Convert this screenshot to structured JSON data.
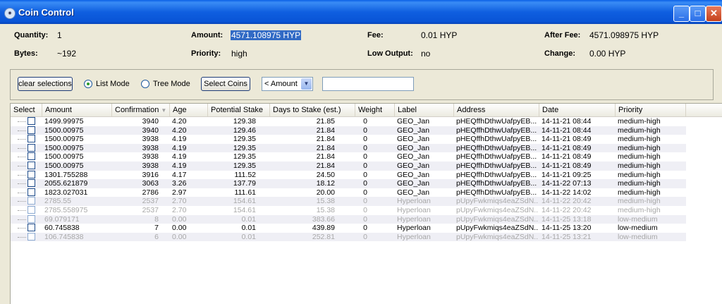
{
  "window": {
    "title": "Coin Control",
    "icon": "app-coin-icon"
  },
  "summary": {
    "quantity_label": "Quantity:",
    "quantity": "1",
    "bytes_label": "Bytes:",
    "bytes": "~192",
    "amount_label": "Amount:",
    "amount": "4571.108975 HYP",
    "priority_label": "Priority:",
    "priority": "high",
    "fee_label": "Fee:",
    "fee": "0.01 HYP",
    "low_output_label": "Low Output:",
    "low_output": "no",
    "after_fee_label": "After Fee:",
    "after_fee": "4571.098975 HYP",
    "change_label": "Change:",
    "change": "0.00 HYP"
  },
  "toolbar": {
    "clear_label": "clear selections",
    "list_mode_label": "List Mode",
    "tree_mode_label": "Tree Mode",
    "select_coins_label": "Select Coins",
    "amount_filter": "< Amount",
    "filter_value": ""
  },
  "table": {
    "headers": {
      "select": "Select",
      "amount": "Amount",
      "confirmations": "Confirmation",
      "age": "Age",
      "stake": "Potential Stake",
      "days": "Days to Stake (est.)",
      "weight": "Weight",
      "label": "Label",
      "address": "Address",
      "date": "Date",
      "priority": "Priority"
    },
    "rows": [
      {
        "amount": "1499.99975",
        "conf": "3940",
        "age": "4.20",
        "stake": "129.38",
        "days": "21.85",
        "weight": "0",
        "label": "GEO_Jan",
        "address": "pHEQffhDthwUafpyEB...",
        "date": "14-11-21 08:44",
        "priority": "medium-high"
      },
      {
        "amount": "1500.00975",
        "conf": "3940",
        "age": "4.20",
        "stake": "129.46",
        "days": "21.84",
        "weight": "0",
        "label": "GEO_Jan",
        "address": "pHEQffhDthwUafpyEB...",
        "date": "14-11-21 08:44",
        "priority": "medium-high"
      },
      {
        "amount": "1500.00975",
        "conf": "3938",
        "age": "4.19",
        "stake": "129.35",
        "days": "21.84",
        "weight": "0",
        "label": "GEO_Jan",
        "address": "pHEQffhDthwUafpyEB...",
        "date": "14-11-21 08:49",
        "priority": "medium-high"
      },
      {
        "amount": "1500.00975",
        "conf": "3938",
        "age": "4.19",
        "stake": "129.35",
        "days": "21.84",
        "weight": "0",
        "label": "GEO_Jan",
        "address": "pHEQffhDthwUafpyEB...",
        "date": "14-11-21 08:49",
        "priority": "medium-high"
      },
      {
        "amount": "1500.00975",
        "conf": "3938",
        "age": "4.19",
        "stake": "129.35",
        "days": "21.84",
        "weight": "0",
        "label": "GEO_Jan",
        "address": "pHEQffhDthwUafpyEB...",
        "date": "14-11-21 08:49",
        "priority": "medium-high"
      },
      {
        "amount": "1500.00975",
        "conf": "3938",
        "age": "4.19",
        "stake": "129.35",
        "days": "21.84",
        "weight": "0",
        "label": "GEO_Jan",
        "address": "pHEQffhDthwUafpyEB...",
        "date": "14-11-21 08:49",
        "priority": "medium-high"
      },
      {
        "amount": "1301.755288",
        "conf": "3916",
        "age": "4.17",
        "stake": "111.52",
        "days": "24.50",
        "weight": "0",
        "label": "GEO_Jan",
        "address": "pHEQffhDthwUafpyEB...",
        "date": "14-11-21 09:25",
        "priority": "medium-high"
      },
      {
        "amount": "2055.621879",
        "conf": "3063",
        "age": "3.26",
        "stake": "137.79",
        "days": "18.12",
        "weight": "0",
        "label": "GEO_Jan",
        "address": "pHEQffhDthwUafpyEB...",
        "date": "14-11-22 07:13",
        "priority": "medium-high"
      },
      {
        "amount": "1823.027031",
        "conf": "2786",
        "age": "2.97",
        "stake": "111.61",
        "days": "20.00",
        "weight": "0",
        "label": "GEO_Jan",
        "address": "pHEQffhDthwUafpyEB...",
        "date": "14-11-22 14:02",
        "priority": "medium-high"
      },
      {
        "amount": "2785.55",
        "conf": "2537",
        "age": "2.70",
        "stake": "154.61",
        "days": "15.38",
        "weight": "0",
        "label": "Hyperloan",
        "address": "pUpyFwkmiqs4eaZSdN...",
        "date": "14-11-22 20:42",
        "priority": "medium-high",
        "dim": true
      },
      {
        "amount": "2785.558975",
        "conf": "2537",
        "age": "2.70",
        "stake": "154.61",
        "days": "15.38",
        "weight": "0",
        "label": "Hyperloan",
        "address": "pUpyFwkmiqs4eaZSdN...",
        "date": "14-11-22 20:42",
        "priority": "medium-high",
        "dim": true
      },
      {
        "amount": "69.079171",
        "conf": "8",
        "age": "0.00",
        "stake": "0.01",
        "days": "383.66",
        "weight": "0",
        "label": "Hyperloan",
        "address": "pUpyFwkmiqs4eaZSdN...",
        "date": "14-11-25 13:18",
        "priority": "low-medium",
        "dim": true
      },
      {
        "amount": "60.745838",
        "conf": "7",
        "age": "0.00",
        "stake": "0.01",
        "days": "439.89",
        "weight": "0",
        "label": "Hyperloan",
        "address": "pUpyFwkmiqs4eaZSdN...",
        "date": "14-11-25 13:20",
        "priority": "low-medium"
      },
      {
        "amount": "106.745838",
        "conf": "6",
        "age": "0.00",
        "stake": "0.01",
        "days": "252.81",
        "weight": "0",
        "label": "Hyperloan",
        "address": "pUpyFwkmiqs4eaZSdN...",
        "date": "14-11-25 13:21",
        "priority": "low-medium",
        "dim": true
      }
    ]
  },
  "colors": {
    "title_blue": "#0a5fe6",
    "selection_blue": "#316ac5",
    "dim_text": "#a8a8a8"
  }
}
